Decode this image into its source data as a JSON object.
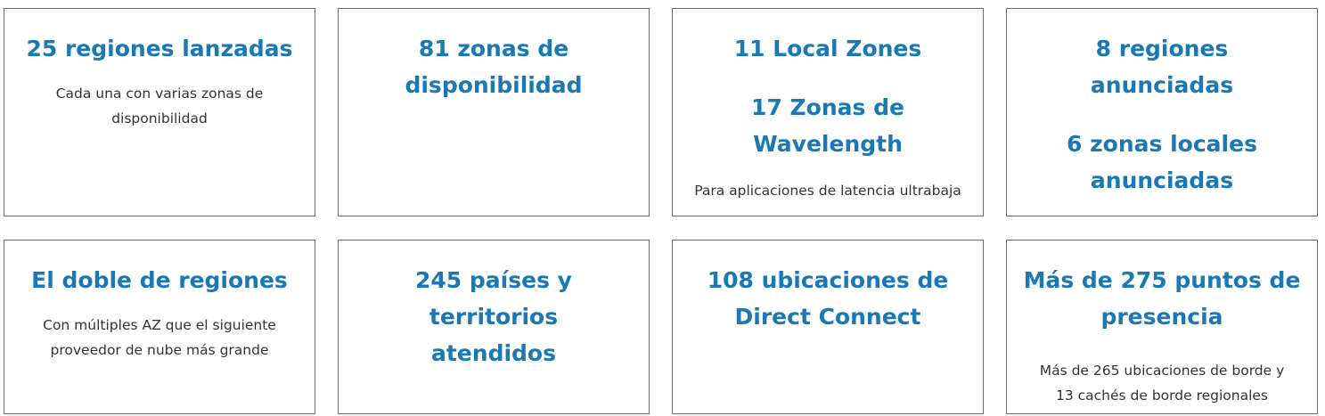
{
  "cards": [
    {
      "headline": "25 regiones lanzadas",
      "desc_line1": "Cada una con varias zonas de",
      "desc_line2": "disponibilidad"
    },
    {
      "headline_line1": "81 zonas de",
      "headline_line2": "disponibilidad"
    },
    {
      "headline1": "11 Local Zones",
      "headline2_line1": "17 Zonas de",
      "headline2_line2": "Wavelength",
      "desc": "Para aplicaciones de latencia ultrabaja"
    },
    {
      "headline1": "8 regiones anunciadas",
      "headline2_line1": "6 zonas locales",
      "headline2_line2": "anunciadas"
    },
    {
      "headline": "El doble de regiones",
      "desc_line1": "Con múltiples AZ que el siguiente",
      "desc_line2": "proveedor de nube más grande"
    },
    {
      "headline_line1": "245 países y territorios",
      "headline_line2": "atendidos"
    },
    {
      "headline_line1": "108 ubicaciones de",
      "headline_line2": "Direct Connect"
    },
    {
      "headline_line1": "Más de 275 puntos de",
      "headline_line2": "presencia",
      "desc_line1": "Más de 265 ubicaciones de borde y",
      "desc_line2": "13 cachés de borde regionales"
    }
  ],
  "colors": {
    "headline": "#1a78b4",
    "text": "#333333",
    "border": "#6b6b6b"
  }
}
